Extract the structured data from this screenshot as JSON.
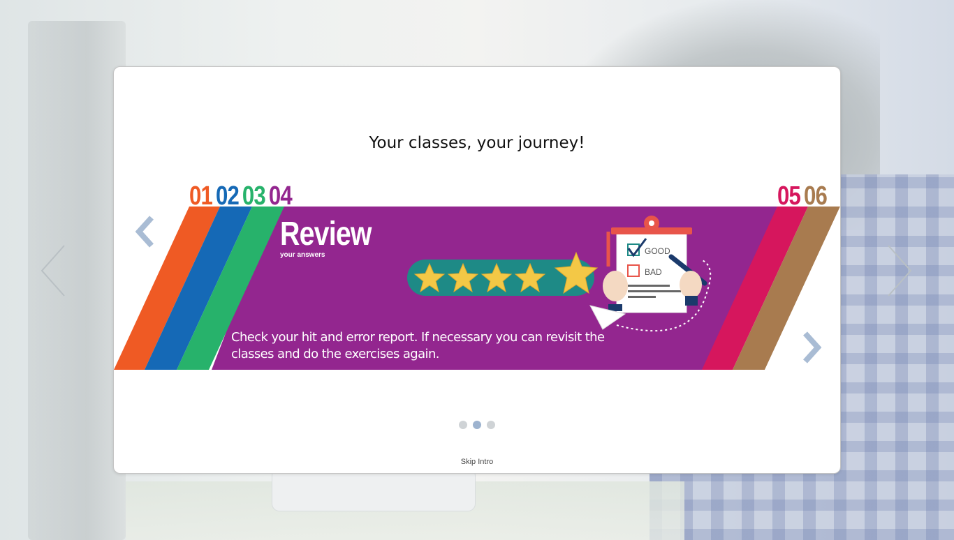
{
  "intro": {
    "title": "Your classes, your journey!",
    "steps_left": [
      "01",
      "02",
      "03",
      "04"
    ],
    "steps_right": [
      "05",
      "06"
    ],
    "step_colors": [
      "#ef5a24",
      "#1569b6",
      "#27b26b",
      "#93268f",
      "#d6165d",
      "#a87b4f"
    ],
    "slide": {
      "heading": "Review",
      "subheading": "your answers",
      "description": "Check your hit and error report. If necessary you can revisit the classes and do the exercises again.",
      "checklist": [
        "GOOD",
        "BAD"
      ],
      "rating_stars": 5
    },
    "pagination": {
      "total": 3,
      "active": 2
    },
    "skip_label": "Skip Intro"
  },
  "icons": {
    "outer_prev": "chevron-left-icon",
    "outer_next": "chevron-right-icon",
    "inner_prev": "chevron-left-icon",
    "inner_next": "chevron-right-icon"
  }
}
